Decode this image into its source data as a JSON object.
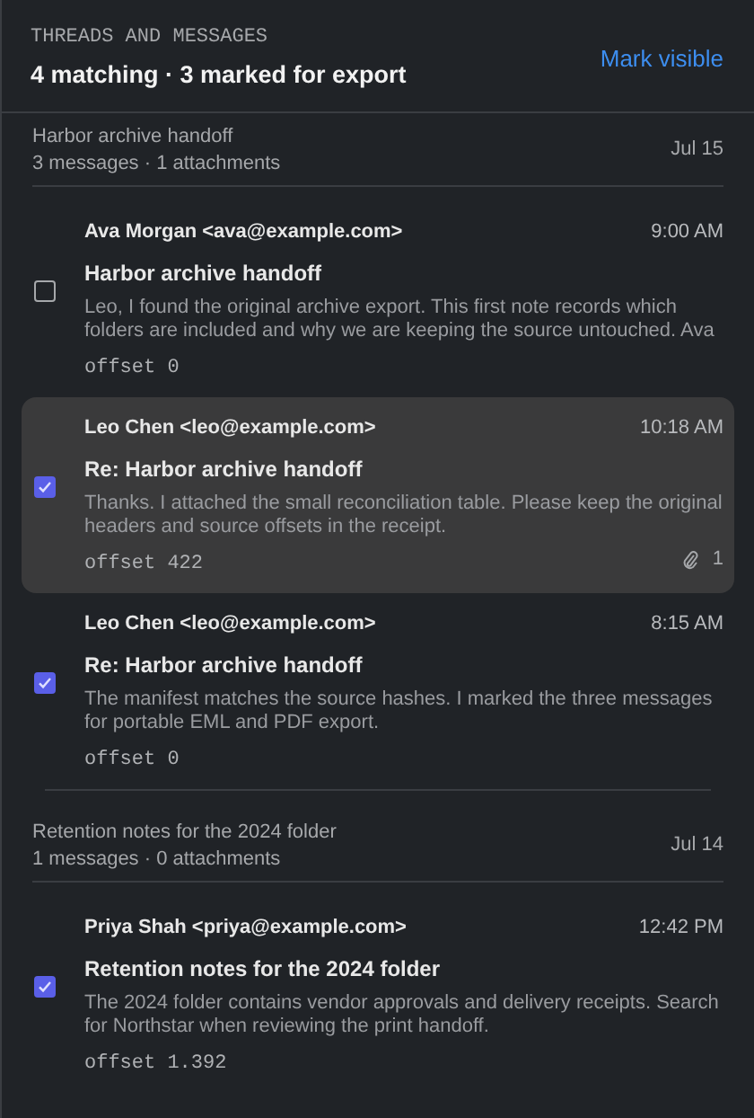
{
  "header": {
    "eyebrow": "THREADS AND MESSAGES",
    "summary": "4 matching · 3 marked for export",
    "action": "Mark visible"
  },
  "threads": [
    {
      "subject": "Harbor archive handoff",
      "meta": "3 messages · 1 attachments",
      "date": "Jul 15",
      "messages": [
        {
          "from": "Ava Morgan <ava@example.com>",
          "time": "9:00 AM",
          "subject": "Harbor archive handoff",
          "body": "Leo, I found the original archive export. This first note records which folders are included and why we are keeping the source untouched. Ava",
          "offset": "offset 0",
          "checked": false,
          "selected": false
        },
        {
          "from": "Leo Chen <leo@example.com>",
          "time": "10:18 AM",
          "subject": "Re: Harbor archive handoff",
          "body": "Thanks. I attached the small reconciliation table. Please keep the original headers and source offsets in the receipt.",
          "offset": "offset 422",
          "attachments": "1",
          "checked": true,
          "selected": true
        },
        {
          "from": "Leo Chen <leo@example.com>",
          "time": "8:15 AM",
          "subject": "Re: Harbor archive handoff",
          "body": "The manifest matches the source hashes. I marked the three messages for portable EML and PDF export.",
          "offset": "offset 0",
          "checked": true,
          "selected": false
        }
      ]
    },
    {
      "subject": "Retention notes for the 2024 folder",
      "meta": "1 messages · 0 attachments",
      "date": "Jul 14",
      "messages": [
        {
          "from": "Priya Shah <priya@example.com>",
          "time": "12:42 PM",
          "subject": "Retention notes for the 2024 folder",
          "body": "The 2024 folder contains vendor approvals and delivery receipts. Search for Northstar when reviewing the print handoff.",
          "offset": "offset 1.392",
          "checked": true,
          "selected": false
        }
      ]
    }
  ]
}
